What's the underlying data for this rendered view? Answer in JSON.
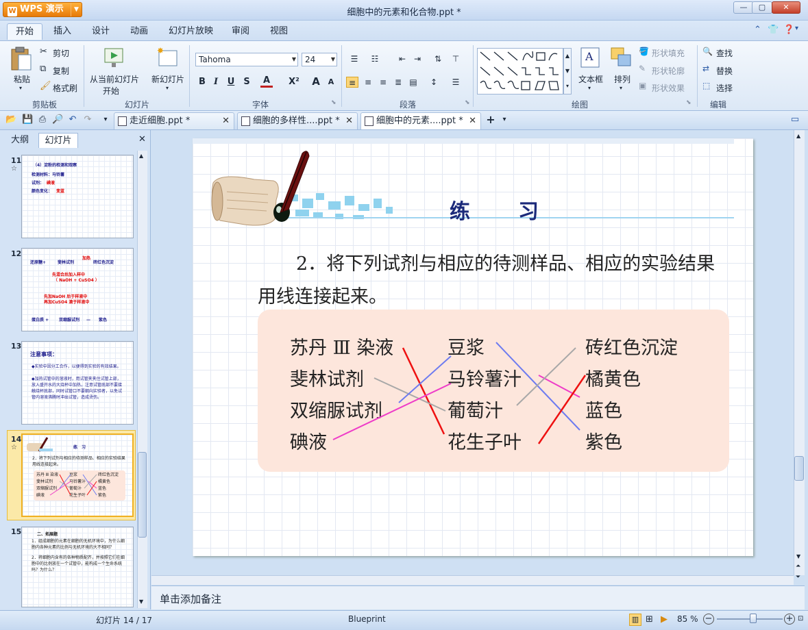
{
  "app": {
    "name": "WPS 演示",
    "logo_char": "W",
    "doc_title": "细胞中的元素和化合物.ppt *"
  },
  "window": {
    "min": "—",
    "max": "▢",
    "close": "✕"
  },
  "menu": {
    "tabs": [
      "开始",
      "插入",
      "设计",
      "动画",
      "幻灯片放映",
      "审阅",
      "视图"
    ],
    "active": 0
  },
  "ribbon": {
    "clipboard": {
      "paste": "粘贴",
      "cut": "剪切",
      "copy": "复制",
      "format_painter": "格式刷",
      "label": "剪贴板"
    },
    "slides": {
      "from_current": "从当前幻灯片",
      "start": "开始",
      "new_slide": "新幻灯片",
      "label": "幻灯片"
    },
    "font": {
      "name": "Tahoma",
      "size": "24",
      "label": "字体",
      "bold": "B",
      "italic": "I",
      "underline": "U",
      "shadow": "S",
      "color": "A",
      "superscript": "X²",
      "grow": "A",
      "shrink": "A"
    },
    "paragraph": {
      "label": "段落"
    },
    "drawing": {
      "textbox": "文本框",
      "arrange": "排列",
      "fill": "形状填充",
      "outline": "形状轮廓",
      "effect": "形状效果",
      "label": "绘图"
    },
    "edit": {
      "find": "查找",
      "replace": "替换",
      "select": "选择",
      "label": "编辑"
    }
  },
  "doc_tabs": [
    {
      "title": "走近细胞.ppt *"
    },
    {
      "title": "细胞的多样性....ppt *"
    },
    {
      "title": "细胞中的元素....ppt *"
    }
  ],
  "left_panel": {
    "tabs": [
      "大纲",
      "幻灯片"
    ],
    "active": 1,
    "close": "✕"
  },
  "thumbnails": [
    {
      "num": "11",
      "star": "☆"
    },
    {
      "num": "12",
      "star": ""
    },
    {
      "num": "13",
      "star": ""
    },
    {
      "num": "14",
      "star": "☆"
    },
    {
      "num": "15",
      "star": ""
    }
  ],
  "thumb_text": {
    "t11": [
      "（4）淀粉的检测和观察",
      "检测材料：马铃薯",
      "试剂：",
      "碘液",
      "颜色变化：",
      "变蓝"
    ],
    "t12": [
      "还原糖+",
      "斐林试剂",
      "加热",
      "砖红色沉淀",
      "先混合后加入样中",
      "（ NaOH + CuSO4 ）",
      "先加NaOH 后于样液中",
      "再加CuSO4 滴于样液中",
      "蛋白质 +",
      "双缩脲试剂",
      "—",
      "紫色"
    ],
    "t13": [
      "注意事项：",
      "◆实验中因分工合作，以便得到实验的有效结果。",
      "◆加热试管中的溶液时，用试管夹夹住试管上部，放入盛开水的大烧杯中加热，注意试管底部不要接触烧杯底部，同时试管口不要朝向实验者，以免试管内溶液沸腾时冲出试管，造成烫伤。"
    ],
    "t14": [
      "练　习",
      "2．将下列试剂与相应的待测样品、相应的实验结果用线连接起来。"
    ],
    "t15": [
      "二、拓展题",
      "1．组成细胞的元素在细胞的无机环境中，为什么细胞内各种元素的比例与无机环境的大不相同？",
      "2．将细胞内含有的各种物质配齐，并按照它们在细胞中的比例放在一个试管中，能构成一个生命系统吗？为什么？"
    ]
  },
  "slide": {
    "title": "练　习",
    "question": "2．将下列试剂与相应的待测样品、相应的实验结果用线连接起来。",
    "reagents": [
      "苏丹 Ⅲ 染液",
      "斐林试剂",
      "双缩脲试剂",
      "碘液"
    ],
    "samples": [
      "豆浆",
      "马铃薯汁",
      "葡萄汁",
      "花生子叶"
    ],
    "results": [
      "砖红色沉淀",
      "橘黄色",
      "蓝色",
      "紫色"
    ],
    "colors": {
      "title": "#1c2a7a",
      "box": "#fde6dc",
      "red": "#ee1111",
      "blue": "#6d7bf0",
      "gray": "#a8a8a8",
      "magenta": "#ee3cc8"
    }
  },
  "notes": {
    "placeholder": "单击添加备注"
  },
  "status": {
    "slide_info": "幻灯片 14 / 17",
    "theme": "Blueprint",
    "zoom": "85 %",
    "zoom_level": 0.55
  }
}
